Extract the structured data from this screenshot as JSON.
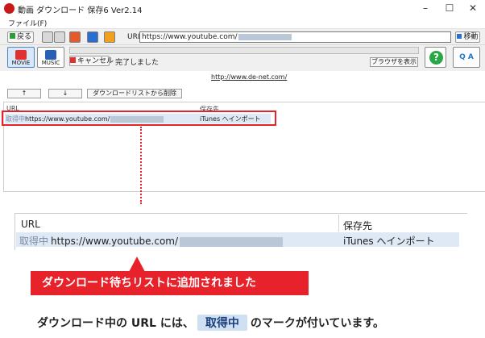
{
  "window": {
    "title": "動画 ダウンロード 保存6 Ver2.14"
  },
  "menu": {
    "file": "ファイル(F)"
  },
  "toolbar": {
    "back_label": "戻る",
    "url_label": "URL:",
    "url_value": "https://www.youtube.com/",
    "go_label": "移動"
  },
  "controls": {
    "movie_label": "MOVIE",
    "music_label": "MUSIC",
    "cancel_label": "キャンセル",
    "status_text": "完了しました",
    "browser_label": "ブラウザを表示",
    "help_symbol": "?",
    "qa_label": "Q A"
  },
  "site_link": "http://www.de-net.com/",
  "list_controls": {
    "up_label": "↑",
    "down_label": "↓",
    "delete_label": "ダウンロードリストから削除"
  },
  "list": {
    "col_url": "URL",
    "col_dest": "保存先",
    "rows": [
      {
        "status": "取得中",
        "url": "https://www.youtube.com/",
        "dest": "iTunes へインポート"
      }
    ]
  },
  "zoom": {
    "col_url": "URL",
    "col_dest": "保存先",
    "status": "取得中",
    "url": "https://www.youtube.com/",
    "dest": "iTunes へインポート"
  },
  "callout": {
    "text": "ダウンロード待ちリストに追加されました"
  },
  "footer": {
    "text_before": "ダウンロード中の URL には、",
    "badge": "取得中",
    "text_after": "のマークが付いています。"
  },
  "colors": {
    "accent_red": "#e8222a",
    "row_highlight": "#dfe9f5",
    "help_green": "#28a745"
  }
}
